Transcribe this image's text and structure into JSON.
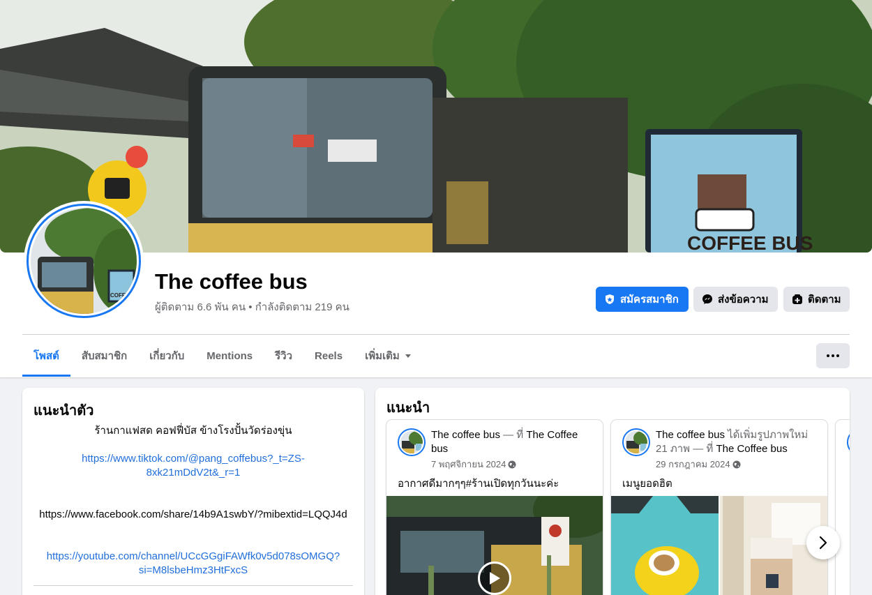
{
  "page": {
    "name": "The coffee bus",
    "stats": "ผู้ติดตาม 6.6 พัน คน • กำลังติดตาม 219 คน"
  },
  "actions": {
    "join": "สมัครสมาชิก",
    "message": "ส่งข้อความ",
    "follow": "ติดตาม"
  },
  "tabs": [
    {
      "label": "โพสต์",
      "active": true
    },
    {
      "label": "สับสมาชิก"
    },
    {
      "label": "เกี่ยวกับ"
    },
    {
      "label": "Mentions"
    },
    {
      "label": "รีวิว"
    },
    {
      "label": "Reels"
    },
    {
      "label": "เพิ่มเติม"
    }
  ],
  "intro": {
    "title": "แนะนำตัว",
    "description": "ร้านกาแฟสด คอฟฟี่บัส ข้างโรงปั้นวัดร่องขุ่น",
    "links": [
      "https://www.tiktok.com/@pang_coffebus?_t=ZS-8xk21mDdV2t&_r=1",
      "https://www.facebook.com/share/14b9A1swbY/?mibextid=LQQJ4d",
      "https://youtube.com/channel/UCcGGgiFAWfk0v5d078sOMGQ?si=M8lsbeHmz3HtFxcS"
    ]
  },
  "featured": {
    "title": "แนะนำ",
    "posts": [
      {
        "author": "The coffee bus",
        "action": " — ที่ ",
        "place": "The Coffee bus",
        "date": "7 พฤศจิกายน 2024",
        "text": "อากาศดีมากๆๆ#ร้านเปิดทุกวันนะค่ะ"
      },
      {
        "author": "The coffee bus",
        "action": " ได้เพิ่มรูปภาพใหม่ 21 ภาพ — ที่ ",
        "place": "The Coffee bus",
        "date": "29 กรกฎาคม 2024",
        "text": "เมนูยอดฮิต"
      }
    ]
  },
  "colors": {
    "accent": "#1877f2",
    "link": "#216fdb",
    "secondary_text": "#65676b",
    "button_gray": "#e4e6eb"
  },
  "icons": [
    "shield-icon",
    "messenger-icon",
    "follow-icon",
    "globe-icon",
    "play-icon",
    "chevron-right-icon",
    "more-icon"
  ]
}
